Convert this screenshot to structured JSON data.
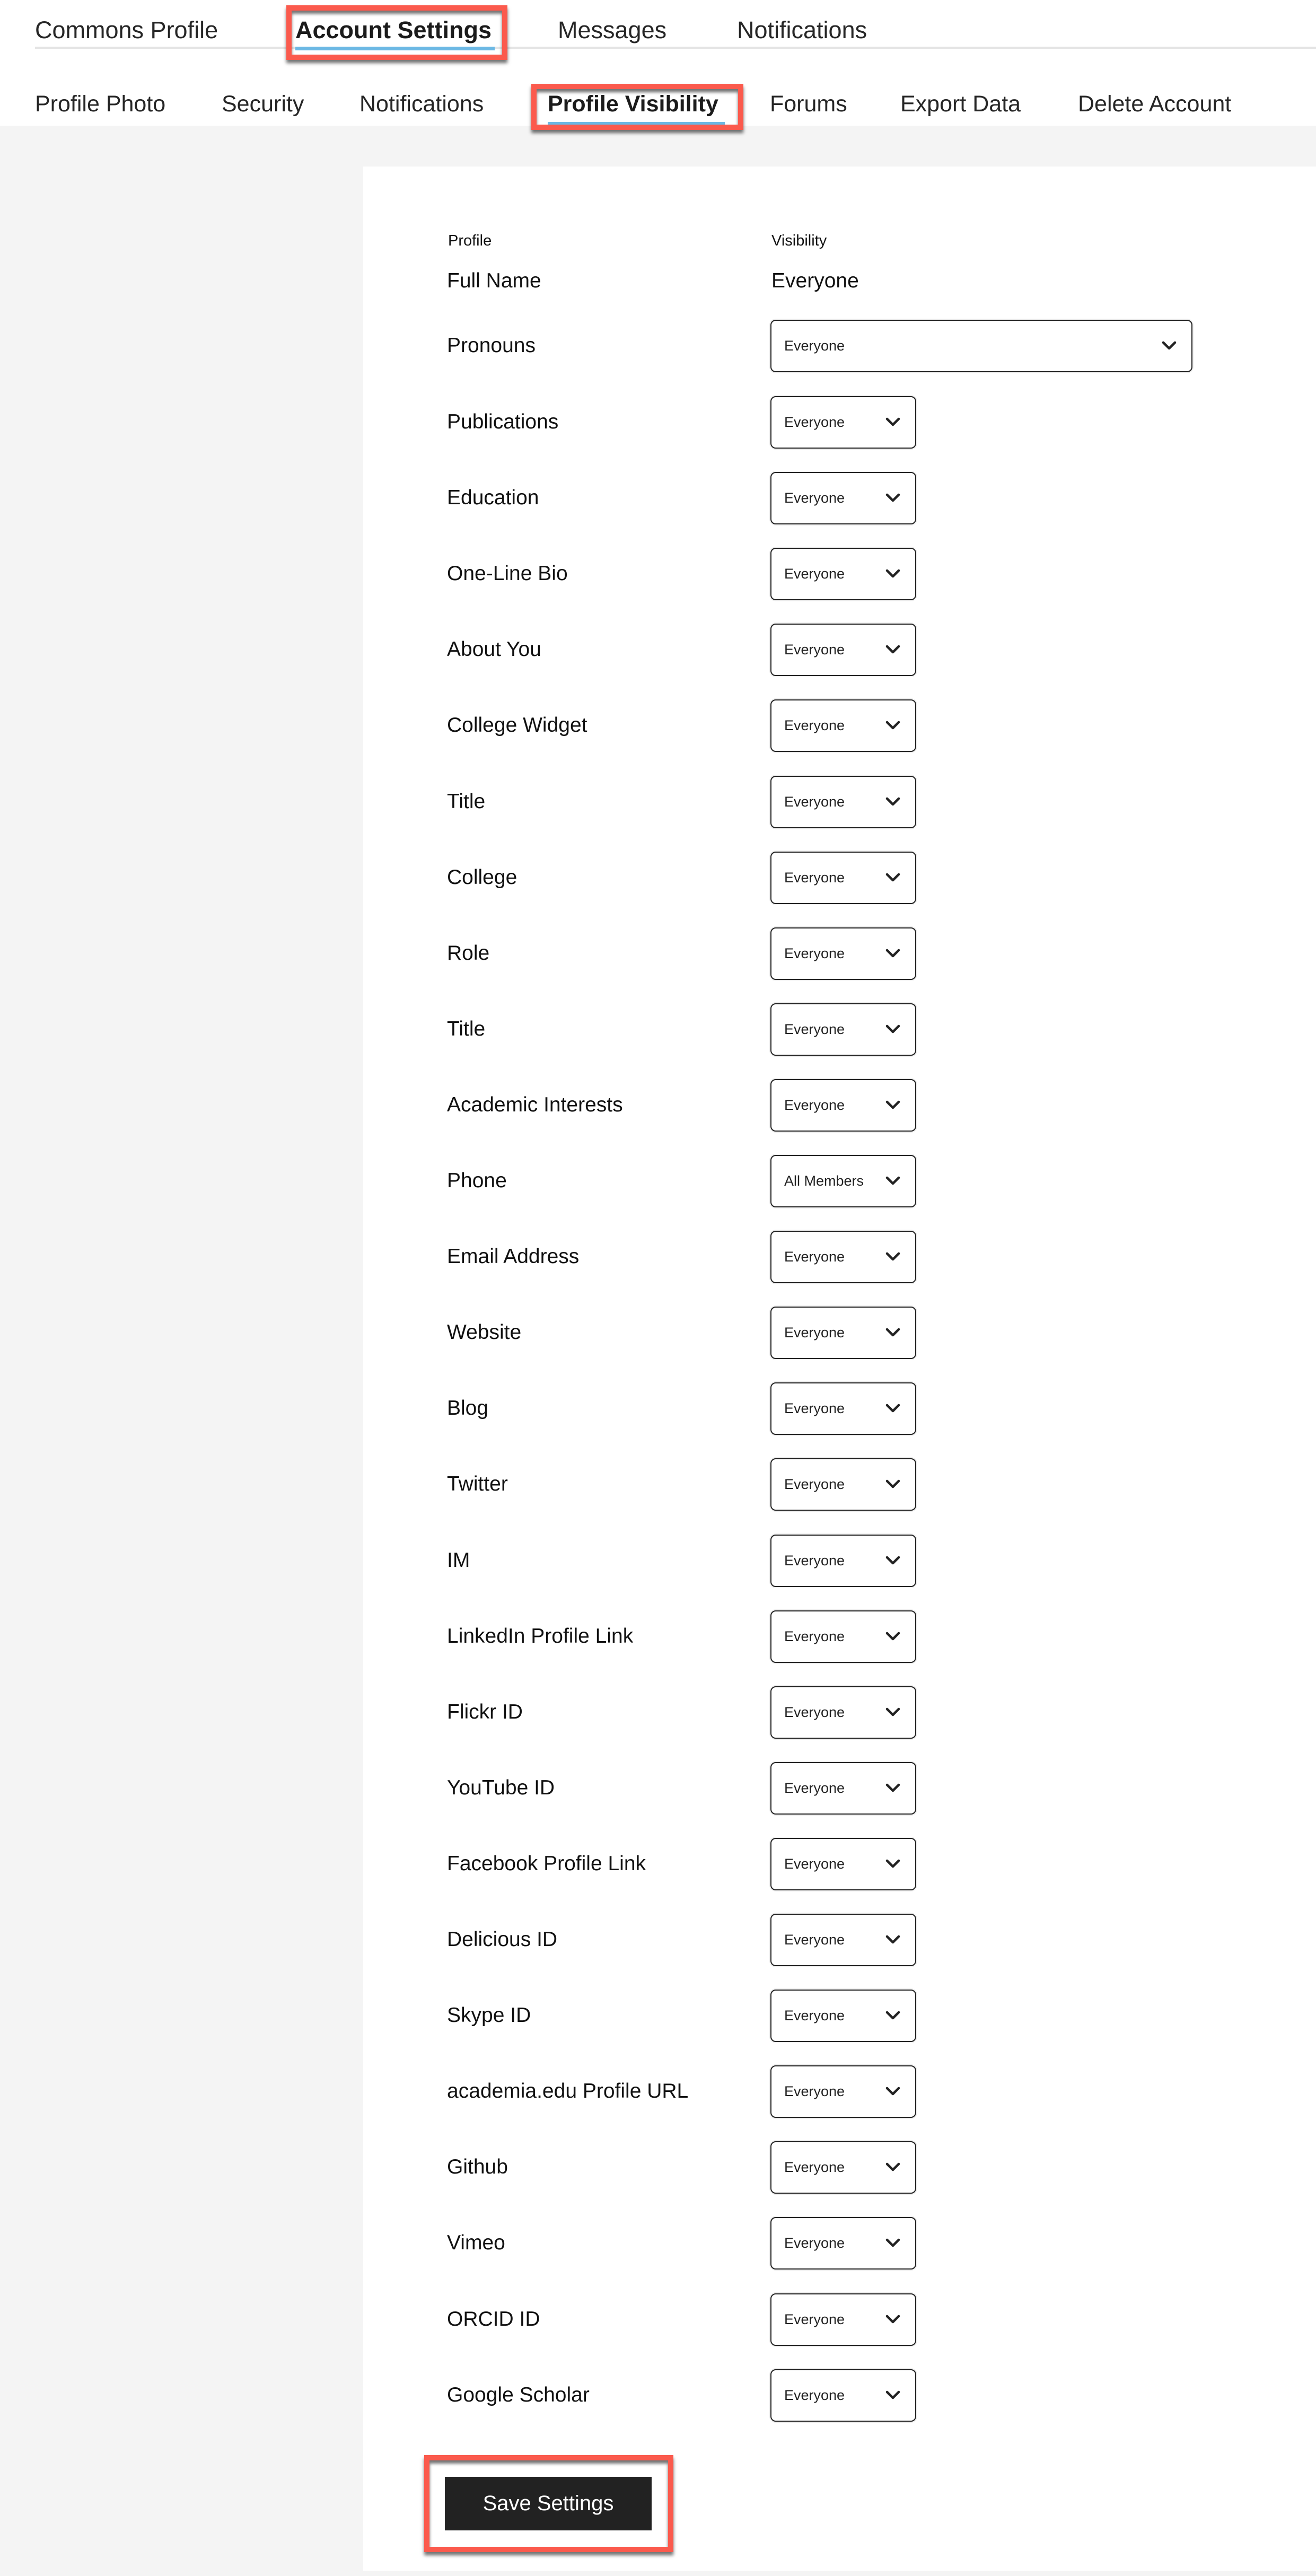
{
  "top_nav": {
    "items": [
      {
        "label": "Commons Profile",
        "active": false
      },
      {
        "label": "Account Settings",
        "active": true
      },
      {
        "label": "Messages",
        "active": false
      },
      {
        "label": "Notifications",
        "active": false
      }
    ]
  },
  "sub_nav": {
    "items": [
      {
        "label": "Profile Photo",
        "active": false
      },
      {
        "label": "Security",
        "active": false
      },
      {
        "label": "Notifications",
        "active": false
      },
      {
        "label": "Profile Visibility",
        "active": true
      },
      {
        "label": "Forums",
        "active": false
      },
      {
        "label": "Export Data",
        "active": false
      },
      {
        "label": "Delete Account",
        "active": false
      }
    ]
  },
  "colors": {
    "highlight": "#fb5a4d",
    "active_underline": "#6cb8e4",
    "page_background": "#f4f4f4",
    "button_background": "#222222"
  },
  "form": {
    "headers": {
      "profile": "Profile",
      "visibility": "Visibility"
    },
    "full_name": {
      "label": "Full Name",
      "value": "Everyone"
    },
    "pronouns": {
      "label": "Pronouns",
      "value": "Everyone"
    },
    "rows": [
      {
        "label": "Publications",
        "value": "Everyone"
      },
      {
        "label": "Education",
        "value": "Everyone"
      },
      {
        "label": "One-Line Bio",
        "value": "Everyone"
      },
      {
        "label": "About You",
        "value": "Everyone"
      },
      {
        "label": "College Widget",
        "value": "Everyone"
      },
      {
        "label": "Title",
        "value": "Everyone"
      },
      {
        "label": "College",
        "value": "Everyone"
      },
      {
        "label": "Role",
        "value": "Everyone"
      },
      {
        "label": "Title",
        "value": "Everyone"
      },
      {
        "label": "Academic Interests",
        "value": "Everyone"
      },
      {
        "label": "Phone",
        "value": "All Members"
      },
      {
        "label": "Email Address",
        "value": "Everyone"
      },
      {
        "label": "Website",
        "value": "Everyone"
      },
      {
        "label": "Blog",
        "value": "Everyone"
      },
      {
        "label": "Twitter",
        "value": "Everyone"
      },
      {
        "label": "IM",
        "value": "Everyone"
      },
      {
        "label": "LinkedIn Profile Link",
        "value": "Everyone"
      },
      {
        "label": "Flickr ID",
        "value": "Everyone"
      },
      {
        "label": "YouTube ID",
        "value": "Everyone"
      },
      {
        "label": "Facebook Profile Link",
        "value": "Everyone"
      },
      {
        "label": "Delicious ID",
        "value": "Everyone"
      },
      {
        "label": "Skype ID",
        "value": "Everyone"
      },
      {
        "label": "academia.edu Profile URL",
        "value": "Everyone"
      },
      {
        "label": "Github",
        "value": "Everyone"
      },
      {
        "label": "Vimeo",
        "value": "Everyone"
      },
      {
        "label": "ORCID ID",
        "value": "Everyone"
      },
      {
        "label": "Google Scholar",
        "value": "Everyone"
      }
    ],
    "save_label": "Save Settings"
  }
}
